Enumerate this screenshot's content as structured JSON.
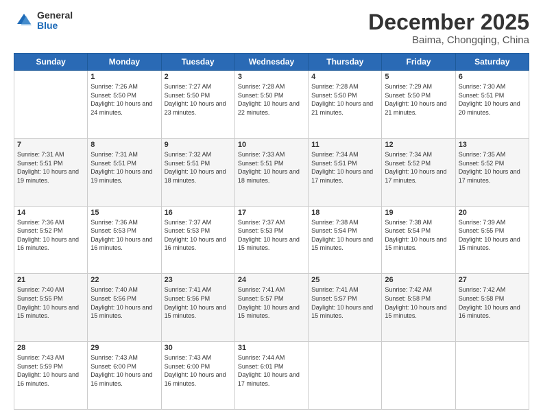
{
  "logo": {
    "general": "General",
    "blue": "Blue"
  },
  "header": {
    "month": "December 2025",
    "location": "Baima, Chongqing, China"
  },
  "weekdays": [
    "Sunday",
    "Monday",
    "Tuesday",
    "Wednesday",
    "Thursday",
    "Friday",
    "Saturday"
  ],
  "weeks": [
    [
      {
        "day": "",
        "sunrise": "",
        "sunset": "",
        "daylight": ""
      },
      {
        "day": "1",
        "sunrise": "Sunrise: 7:26 AM",
        "sunset": "Sunset: 5:50 PM",
        "daylight": "Daylight: 10 hours and 24 minutes."
      },
      {
        "day": "2",
        "sunrise": "Sunrise: 7:27 AM",
        "sunset": "Sunset: 5:50 PM",
        "daylight": "Daylight: 10 hours and 23 minutes."
      },
      {
        "day": "3",
        "sunrise": "Sunrise: 7:28 AM",
        "sunset": "Sunset: 5:50 PM",
        "daylight": "Daylight: 10 hours and 22 minutes."
      },
      {
        "day": "4",
        "sunrise": "Sunrise: 7:28 AM",
        "sunset": "Sunset: 5:50 PM",
        "daylight": "Daylight: 10 hours and 21 minutes."
      },
      {
        "day": "5",
        "sunrise": "Sunrise: 7:29 AM",
        "sunset": "Sunset: 5:50 PM",
        "daylight": "Daylight: 10 hours and 21 minutes."
      },
      {
        "day": "6",
        "sunrise": "Sunrise: 7:30 AM",
        "sunset": "Sunset: 5:51 PM",
        "daylight": "Daylight: 10 hours and 20 minutes."
      }
    ],
    [
      {
        "day": "7",
        "sunrise": "Sunrise: 7:31 AM",
        "sunset": "Sunset: 5:51 PM",
        "daylight": "Daylight: 10 hours and 19 minutes."
      },
      {
        "day": "8",
        "sunrise": "Sunrise: 7:31 AM",
        "sunset": "Sunset: 5:51 PM",
        "daylight": "Daylight: 10 hours and 19 minutes."
      },
      {
        "day": "9",
        "sunrise": "Sunrise: 7:32 AM",
        "sunset": "Sunset: 5:51 PM",
        "daylight": "Daylight: 10 hours and 18 minutes."
      },
      {
        "day": "10",
        "sunrise": "Sunrise: 7:33 AM",
        "sunset": "Sunset: 5:51 PM",
        "daylight": "Daylight: 10 hours and 18 minutes."
      },
      {
        "day": "11",
        "sunrise": "Sunrise: 7:34 AM",
        "sunset": "Sunset: 5:51 PM",
        "daylight": "Daylight: 10 hours and 17 minutes."
      },
      {
        "day": "12",
        "sunrise": "Sunrise: 7:34 AM",
        "sunset": "Sunset: 5:52 PM",
        "daylight": "Daylight: 10 hours and 17 minutes."
      },
      {
        "day": "13",
        "sunrise": "Sunrise: 7:35 AM",
        "sunset": "Sunset: 5:52 PM",
        "daylight": "Daylight: 10 hours and 17 minutes."
      }
    ],
    [
      {
        "day": "14",
        "sunrise": "Sunrise: 7:36 AM",
        "sunset": "Sunset: 5:52 PM",
        "daylight": "Daylight: 10 hours and 16 minutes."
      },
      {
        "day": "15",
        "sunrise": "Sunrise: 7:36 AM",
        "sunset": "Sunset: 5:53 PM",
        "daylight": "Daylight: 10 hours and 16 minutes."
      },
      {
        "day": "16",
        "sunrise": "Sunrise: 7:37 AM",
        "sunset": "Sunset: 5:53 PM",
        "daylight": "Daylight: 10 hours and 16 minutes."
      },
      {
        "day": "17",
        "sunrise": "Sunrise: 7:37 AM",
        "sunset": "Sunset: 5:53 PM",
        "daylight": "Daylight: 10 hours and 15 minutes."
      },
      {
        "day": "18",
        "sunrise": "Sunrise: 7:38 AM",
        "sunset": "Sunset: 5:54 PM",
        "daylight": "Daylight: 10 hours and 15 minutes."
      },
      {
        "day": "19",
        "sunrise": "Sunrise: 7:38 AM",
        "sunset": "Sunset: 5:54 PM",
        "daylight": "Daylight: 10 hours and 15 minutes."
      },
      {
        "day": "20",
        "sunrise": "Sunrise: 7:39 AM",
        "sunset": "Sunset: 5:55 PM",
        "daylight": "Daylight: 10 hours and 15 minutes."
      }
    ],
    [
      {
        "day": "21",
        "sunrise": "Sunrise: 7:40 AM",
        "sunset": "Sunset: 5:55 PM",
        "daylight": "Daylight: 10 hours and 15 minutes."
      },
      {
        "day": "22",
        "sunrise": "Sunrise: 7:40 AM",
        "sunset": "Sunset: 5:56 PM",
        "daylight": "Daylight: 10 hours and 15 minutes."
      },
      {
        "day": "23",
        "sunrise": "Sunrise: 7:41 AM",
        "sunset": "Sunset: 5:56 PM",
        "daylight": "Daylight: 10 hours and 15 minutes."
      },
      {
        "day": "24",
        "sunrise": "Sunrise: 7:41 AM",
        "sunset": "Sunset: 5:57 PM",
        "daylight": "Daylight: 10 hours and 15 minutes."
      },
      {
        "day": "25",
        "sunrise": "Sunrise: 7:41 AM",
        "sunset": "Sunset: 5:57 PM",
        "daylight": "Daylight: 10 hours and 15 minutes."
      },
      {
        "day": "26",
        "sunrise": "Sunrise: 7:42 AM",
        "sunset": "Sunset: 5:58 PM",
        "daylight": "Daylight: 10 hours and 15 minutes."
      },
      {
        "day": "27",
        "sunrise": "Sunrise: 7:42 AM",
        "sunset": "Sunset: 5:58 PM",
        "daylight": "Daylight: 10 hours and 16 minutes."
      }
    ],
    [
      {
        "day": "28",
        "sunrise": "Sunrise: 7:43 AM",
        "sunset": "Sunset: 5:59 PM",
        "daylight": "Daylight: 10 hours and 16 minutes."
      },
      {
        "day": "29",
        "sunrise": "Sunrise: 7:43 AM",
        "sunset": "Sunset: 6:00 PM",
        "daylight": "Daylight: 10 hours and 16 minutes."
      },
      {
        "day": "30",
        "sunrise": "Sunrise: 7:43 AM",
        "sunset": "Sunset: 6:00 PM",
        "daylight": "Daylight: 10 hours and 16 minutes."
      },
      {
        "day": "31",
        "sunrise": "Sunrise: 7:44 AM",
        "sunset": "Sunset: 6:01 PM",
        "daylight": "Daylight: 10 hours and 17 minutes."
      },
      {
        "day": "",
        "sunrise": "",
        "sunset": "",
        "daylight": ""
      },
      {
        "day": "",
        "sunrise": "",
        "sunset": "",
        "daylight": ""
      },
      {
        "day": "",
        "sunrise": "",
        "sunset": "",
        "daylight": ""
      }
    ]
  ]
}
